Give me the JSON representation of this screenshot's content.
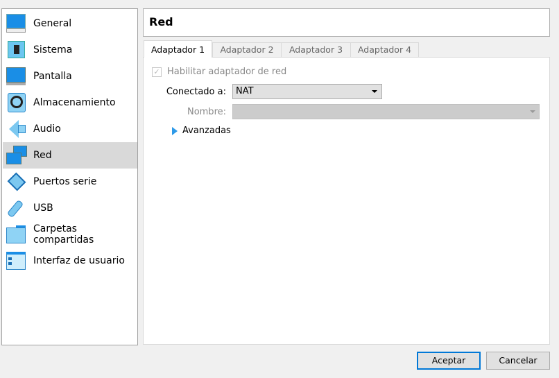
{
  "sidebar": {
    "items": [
      {
        "label": "General",
        "icon": "general-monitor-icon"
      },
      {
        "label": "Sistema",
        "icon": "chip-icon"
      },
      {
        "label": "Pantalla",
        "icon": "display-icon"
      },
      {
        "label": "Almacenamiento",
        "icon": "disk-icon"
      },
      {
        "label": "Audio",
        "icon": "speaker-icon"
      },
      {
        "label": "Red",
        "icon": "network-icon",
        "selected": true
      },
      {
        "label": "Puertos serie",
        "icon": "serial-port-icon"
      },
      {
        "label": "USB",
        "icon": "usb-icon"
      },
      {
        "label": "Carpetas compartidas",
        "icon": "folder-icon"
      },
      {
        "label": "Interfaz de usuario",
        "icon": "user-interface-icon"
      }
    ]
  },
  "header": {
    "title": "Red"
  },
  "tabs": [
    {
      "label": "Adaptador 1",
      "active": true
    },
    {
      "label": "Adaptador 2"
    },
    {
      "label": "Adaptador 3"
    },
    {
      "label": "Adaptador 4"
    }
  ],
  "adapter": {
    "enable_label": "Habilitar adaptador de red",
    "enabled": true,
    "connected_label": "Conectado a:",
    "connected_value": "NAT",
    "name_label": "Nombre:",
    "name_value": "",
    "advanced_label": "Avanzadas"
  },
  "buttons": {
    "ok": "Aceptar",
    "cancel": "Cancelar"
  },
  "colors": {
    "accent": "#0078d7",
    "selected_bg": "#d9d9d9",
    "icon_blue": "#1a8ee6"
  }
}
